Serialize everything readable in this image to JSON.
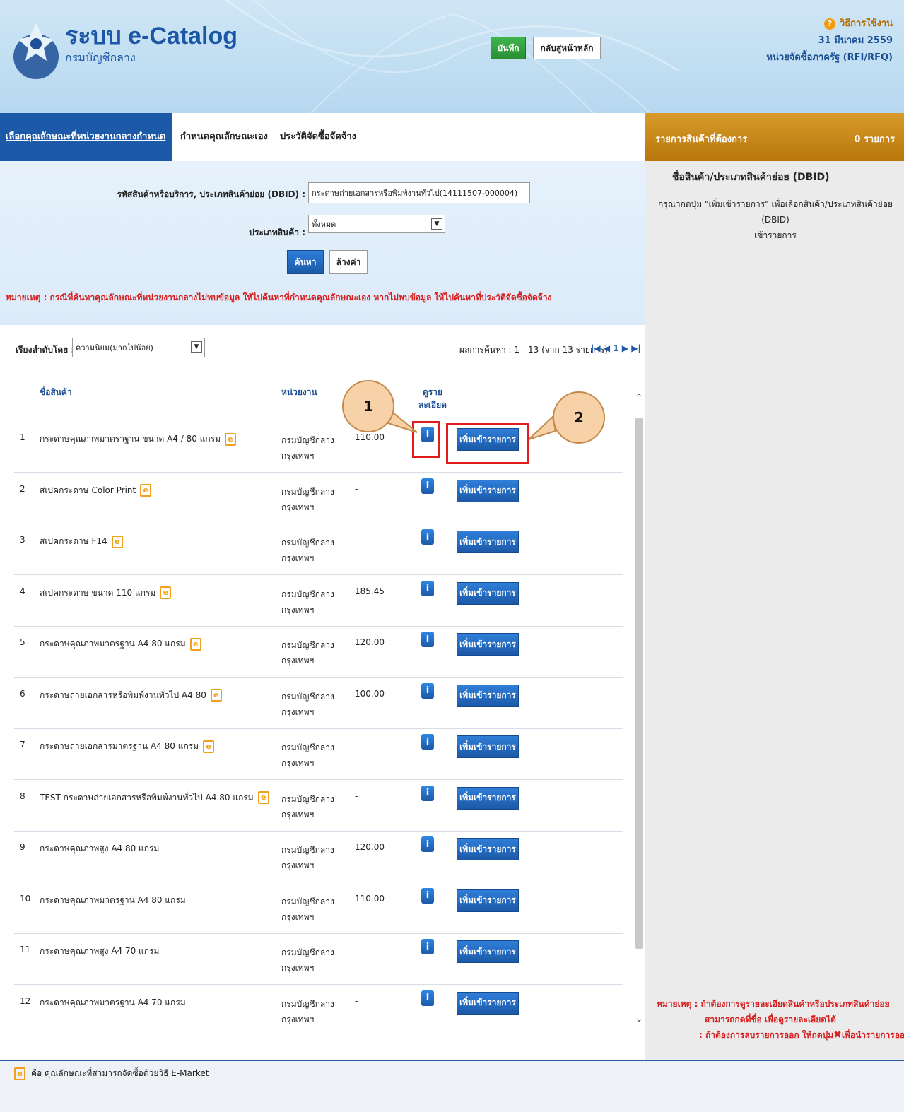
{
  "header": {
    "brand_title": "ระบบ e-Catalog",
    "brand_sub": "กรมบัญชีกลาง",
    "help_label": "วิธีการใช้งาน",
    "date": "31 มีนาคม 2559",
    "unit": "หน่วยจัดซื้อภาครัฐ (RFI/RFQ)"
  },
  "tabs": [
    {
      "label": "เลือกคุณลักษณะที่หน่วยงานกลางกำหนด",
      "active": true
    },
    {
      "label": "กำหนดคุณลักษณะเอง",
      "active": false
    },
    {
      "label": "ประวัติจัดซื้อจัดจ้าง",
      "active": false
    }
  ],
  "search": {
    "code_label": "รหัสสินค้าหรือบริการ, ประเภทสินค้าย่อย (DBID) :",
    "code_value": "กระดาษถ่ายเอกสารหรือพิมพ์งานทั่วไป(14111507-000004)",
    "type_label": "ประเภทสินค้า :",
    "type_value": "ทั้งหมด",
    "search_btn": "ค้นหา",
    "reset_btn": "ล้างค่า",
    "note": "หมายเหตุ : กรณีที่ค้นหาคุณลักษณะที่หน่วยงานกลางไม่พบข้อมูล ให้ไปค้นหาที่กำหนดคุณลักษณะเอง หากไม่พบข้อมูล ให้ไปค้นหาที่ประวัติจัดซื้อจัดจ้าง"
  },
  "list": {
    "sort_label": "เรียงลำดับโดย :",
    "sort_value": "ความนิยม(มากไปน้อย)",
    "result_info": "ผลการค้นหา : 1 - 13 (จาก 13 รายการ)",
    "page": "1",
    "col_name": "ชื่อสินค้า",
    "col_agency": "หน่วยงาน",
    "col_detail_1": "ดูราย",
    "col_detail_2": "ละเอียด",
    "add_label": "เพิ่มเข้ารายการ",
    "info_glyph": "i",
    "e_glyph": "e",
    "rows": [
      {
        "no": "1",
        "name": "กระดาษคุณภาพมาตราฐาน ขนาด A4 / 80 แกรม",
        "e": true,
        "agency1": "กรมบัญชีกลาง",
        "agency2": "กรุงเทพฯ",
        "price": "110.00"
      },
      {
        "no": "2",
        "name": "สเปคกระดาษ Color Print",
        "e": true,
        "agency1": "กรมบัญชีกลาง",
        "agency2": "กรุงเทพฯ",
        "price": "-"
      },
      {
        "no": "3",
        "name": "สเปคกระดาษ F14",
        "e": true,
        "agency1": "กรมบัญชีกลาง",
        "agency2": "กรุงเทพฯ",
        "price": "-"
      },
      {
        "no": "4",
        "name": "สเปคกระดาษ ขนาด 110 แกรม",
        "e": true,
        "agency1": "กรมบัญชีกลาง",
        "agency2": "กรุงเทพฯ",
        "price": "185.45"
      },
      {
        "no": "5",
        "name": "กระดาษคุณภาพมาตรฐาน A4 80 แกรม",
        "e": true,
        "agency1": "กรมบัญชีกลาง",
        "agency2": "กรุงเทพฯ",
        "price": "120.00"
      },
      {
        "no": "6",
        "name": "กระดาษถ่ายเอกสารหรือพิมพ์งานทั่วไป A4 80",
        "e": true,
        "agency1": "กรมบัญชีกลาง",
        "agency2": "กรุงเทพฯ",
        "price": "100.00"
      },
      {
        "no": "7",
        "name": "กระดาษถ่ายเอกสารมาตรฐาน A4 80 แกรม",
        "e": true,
        "agency1": "กรมบัญชีกลาง",
        "agency2": "กรุงเทพฯ",
        "price": "-"
      },
      {
        "no": "8",
        "name": "TEST กระดาษถ่ายเอกสารหรือพิมพ์งานทั่วไป A4 80 แกรม",
        "e": true,
        "agency1": "กรมบัญชีกลาง",
        "agency2": "กรุงเทพฯ",
        "price": "-"
      },
      {
        "no": "9",
        "name": "กระดาษคุณภาพสูง A4 80 แกรม",
        "e": false,
        "agency1": "กรมบัญชีกลาง",
        "agency2": "กรุงเทพฯ",
        "price": "120.00"
      },
      {
        "no": "10",
        "name": "กระดาษคุณภาพมาตรฐาน A4 80 แกรม",
        "e": false,
        "agency1": "กรมบัญชีกลาง",
        "agency2": "กรุงเทพฯ",
        "price": "110.00"
      },
      {
        "no": "11",
        "name": "กระดาษคุณภาพสูง A4 70 แกรม",
        "e": false,
        "agency1": "กรมบัญชีกลาง",
        "agency2": "กรุงเทพฯ",
        "price": "-"
      },
      {
        "no": "12",
        "name": "กระดาษคุณภาพมาตรฐาน A4 70 แกรม",
        "e": false,
        "agency1": "กรมบัญชีกลาง",
        "agency2": "กรุงเทพฯ",
        "price": "-"
      }
    ]
  },
  "cart": {
    "title": "รายการสินค้าที่ต้องการ",
    "count": "0 รายการ",
    "sub_title": "ชื่อสินค้า/ประเภทสินค้าย่อย (DBID)",
    "help_1": "กรุณากดปุ่ม \"เพิ่มเข้ารายการ\" เพื่อเลือกสินค้า/ประเภทสินค้าย่อย (DBID)",
    "help_2": "เข้ารายการ",
    "note_1": "หมายเหตุ : ถ้าต้องการดูรายละเอียดสินค้าหรือประเภทสินค้าย่อย",
    "note_2": "สามารถกดที่ชื่อ เพื่อดูรายละเอียดได้",
    "note_3a": ": ถ้าต้องการลบรายการออก ให้กดปุ่ม",
    "note_3b": "เพื่อนำรายการออก"
  },
  "footer": {
    "e_note": "คือ คุณลักษณะที่สามารถจัดซื้อด้วยวิธี E-Market",
    "save_btn": "บันทึก",
    "home_btn": "กลับสู่หน้าหลัก"
  },
  "annotations": {
    "callout_1": "1",
    "callout_2": "2"
  },
  "colors": {
    "primary_blue": "#1c59a8",
    "orange": "#c88a1d",
    "red": "#d61f1f",
    "green": "#2a8f33"
  }
}
